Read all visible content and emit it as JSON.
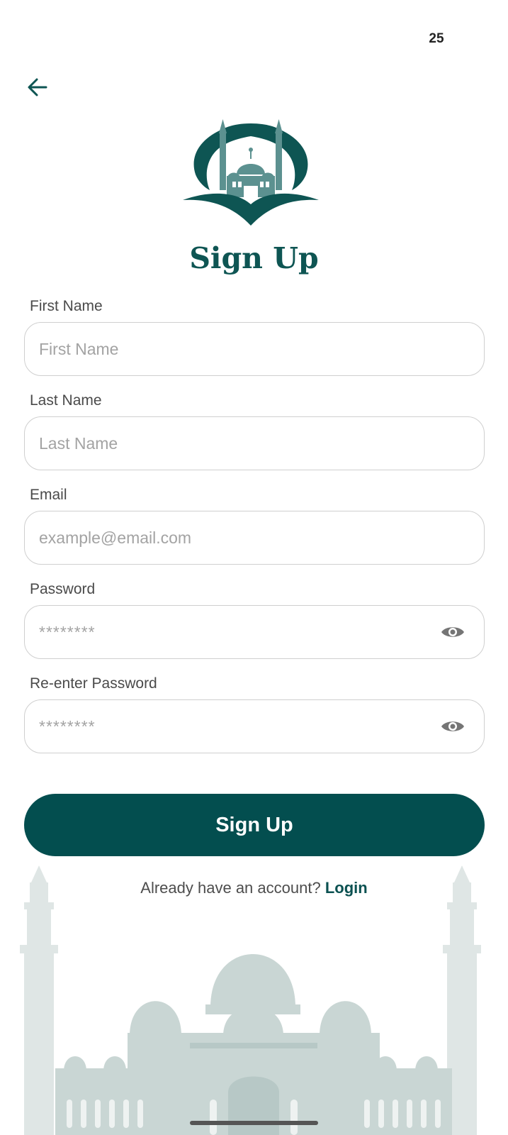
{
  "status_bar": {
    "time": "25"
  },
  "header": {
    "back_icon": "arrow-left-icon"
  },
  "logo": {
    "icon": "mosque-book-logo",
    "color": "#0e5553"
  },
  "title": "Sign Up",
  "form": {
    "first_name": {
      "label": "First Name",
      "placeholder": "First Name"
    },
    "last_name": {
      "label": "Last Name",
      "placeholder": "Last Name"
    },
    "email": {
      "label": "Email",
      "placeholder": "example@email.com"
    },
    "password": {
      "label": "Password",
      "placeholder": "********",
      "toggle_icon": "eye-icon"
    },
    "confirm_password": {
      "label": "Re-enter Password",
      "placeholder": "********",
      "toggle_icon": "eye-icon"
    }
  },
  "submit_label": "Sign Up",
  "footer": {
    "prompt": "Already have an account?",
    "link": "Login"
  },
  "colors": {
    "primary": "#034e4f",
    "accent": "#0e5553",
    "border": "#cfcfcf",
    "placeholder": "#a3a3a3"
  }
}
